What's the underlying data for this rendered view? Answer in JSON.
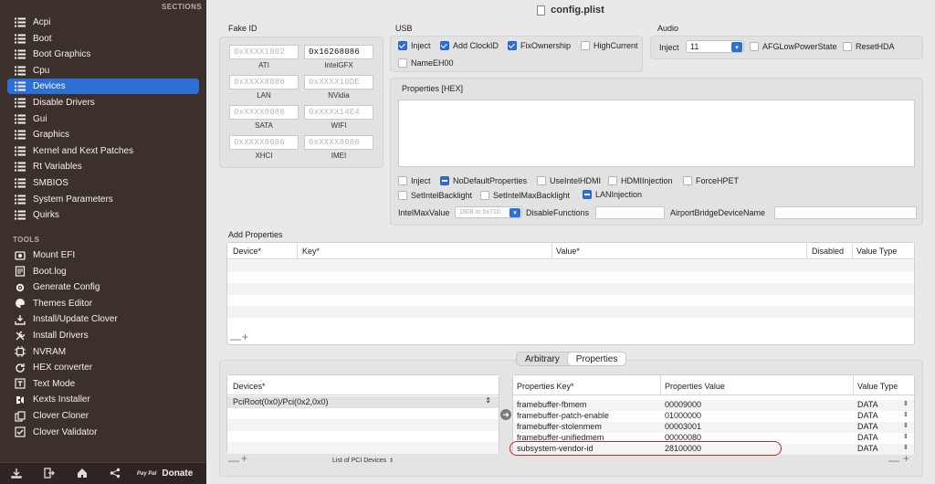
{
  "window": {
    "title": "config.plist"
  },
  "sidebar": {
    "sections_label": "SECTIONS",
    "tools_label": "TOOLS",
    "sections": [
      {
        "label": "Acpi",
        "icon": "list-icon"
      },
      {
        "label": "Boot",
        "icon": "list-icon"
      },
      {
        "label": "Boot Graphics",
        "icon": "list-icon"
      },
      {
        "label": "Cpu",
        "icon": "list-icon"
      },
      {
        "label": "Devices",
        "icon": "list-icon",
        "active": true
      },
      {
        "label": "Disable Drivers",
        "icon": "list-icon"
      },
      {
        "label": "Gui",
        "icon": "list-icon"
      },
      {
        "label": "Graphics",
        "icon": "list-icon"
      },
      {
        "label": "Kernel and Kext Patches",
        "icon": "list-icon"
      },
      {
        "label": "Rt Variables",
        "icon": "list-icon"
      },
      {
        "label": "SMBIOS",
        "icon": "list-icon"
      },
      {
        "label": "System Parameters",
        "icon": "list-icon"
      },
      {
        "label": "Quirks",
        "icon": "list-icon"
      }
    ],
    "tools": [
      {
        "label": "Mount EFI",
        "icon": "disk-icon"
      },
      {
        "label": "Boot.log",
        "icon": "log-icon"
      },
      {
        "label": "Generate Config",
        "icon": "gear-icon"
      },
      {
        "label": "Themes Editor",
        "icon": "palette-icon"
      },
      {
        "label": "Install/Update Clover",
        "icon": "install-icon"
      },
      {
        "label": "Install Drivers",
        "icon": "wrench-icon"
      },
      {
        "label": "NVRAM",
        "icon": "chip-icon"
      },
      {
        "label": "HEX converter",
        "icon": "refresh-icon"
      },
      {
        "label": "Text Mode",
        "icon": "text-icon"
      },
      {
        "label": "Kexts Installer",
        "icon": "kext-icon"
      },
      {
        "label": "Clover Cloner",
        "icon": "clone-icon"
      },
      {
        "label": "Clover Validator",
        "icon": "validator-icon"
      }
    ],
    "bottom": {
      "donate_label": "Donate",
      "paypal_label": "Pay Pal"
    }
  },
  "fake_id": {
    "label": "Fake ID",
    "fields": [
      {
        "caption": "ATI",
        "value": "",
        "placeholder": "0xXXXX1002"
      },
      {
        "caption": "IntelGFX",
        "value": "0x16268086",
        "placeholder": ""
      },
      {
        "caption": "LAN",
        "value": "",
        "placeholder": "0xXXXX8086"
      },
      {
        "caption": "NVidia",
        "value": "",
        "placeholder": "0xXXXX10DE"
      },
      {
        "caption": "SATA",
        "value": "",
        "placeholder": "0xXXXX8086"
      },
      {
        "caption": "WIFI",
        "value": "",
        "placeholder": "0xXXXX14E4"
      },
      {
        "caption": "XHCI",
        "value": "",
        "placeholder": "0xXXXX8086"
      },
      {
        "caption": "IMEI",
        "value": "",
        "placeholder": "0xXXXX8086"
      }
    ]
  },
  "usb": {
    "label": "USB",
    "checks": [
      {
        "label": "Inject",
        "checked": true
      },
      {
        "label": "Add ClockID",
        "checked": true
      },
      {
        "label": "FixOwnership",
        "checked": true
      },
      {
        "label": "HighCurrent",
        "checked": false
      },
      {
        "label": "NameEH00",
        "checked": false
      }
    ]
  },
  "audio": {
    "label": "Audio",
    "inject_label": "Inject",
    "inject_value": "11",
    "checks": [
      {
        "label": "AFGLowPowerState",
        "checked": false
      },
      {
        "label": "ResetHDA",
        "checked": false
      }
    ]
  },
  "properties_hex": {
    "label": "Properties [HEX]",
    "value": "",
    "checks": [
      {
        "label": "Inject",
        "state": "off"
      },
      {
        "label": "NoDefaultProperties",
        "state": "mixed"
      },
      {
        "label": "UseIntelHDMI",
        "state": "off"
      },
      {
        "label": "HDMIInjection",
        "state": "off"
      },
      {
        "label": "ForceHPET",
        "state": "off"
      },
      {
        "label": "SetIntelBacklight",
        "state": "off"
      },
      {
        "label": "SetIntelMaxBacklight",
        "state": "off"
      },
      {
        "label": "LANInjection",
        "state": "mixed"
      }
    ],
    "intel_max_value_label": "IntelMaxValue",
    "intel_max_value_placeholder": "1808 or 0x710",
    "disable_functions_label": "DisableFunctions",
    "airport_label": "AirportBridgeDeviceName"
  },
  "add_properties": {
    "label": "Add Properties",
    "columns": [
      "Device*",
      "Key*",
      "Value*",
      "Disabled",
      "Value Type"
    ],
    "rows": []
  },
  "tabs": [
    {
      "label": "Arbitrary",
      "active": false
    },
    {
      "label": "Properties",
      "active": true
    }
  ],
  "devices_table": {
    "column": "Devices*",
    "rows": [
      "PciRoot(0x0)/Pci(0x2,0x0)"
    ],
    "footer_label": "List of PCI Devices"
  },
  "properties_table": {
    "columns": [
      "Properties Key*",
      "Properties Value",
      "Value Type"
    ],
    "rows": [
      {
        "key": "framebuffer-fbmem",
        "value": "00009000",
        "type": "DATA"
      },
      {
        "key": "framebuffer-patch-enable",
        "value": "01000000",
        "type": "DATA"
      },
      {
        "key": "framebuffer-stolenmem",
        "value": "00003001",
        "type": "DATA"
      },
      {
        "key": "framebuffer-unifiedmem",
        "value": "00000080",
        "type": "DATA"
      },
      {
        "key": "subsystem-vendor-id",
        "value": "28100000",
        "type": "DATA",
        "highlighted": true
      }
    ]
  },
  "colors": {
    "accent": "#2e6fd6",
    "sidebar_bg": "#3b302c",
    "highlight_ring": "#c0282d"
  }
}
